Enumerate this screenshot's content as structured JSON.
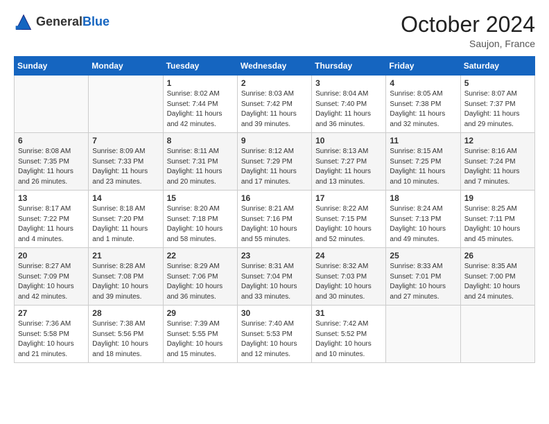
{
  "header": {
    "logo_general": "General",
    "logo_blue": "Blue",
    "month_title": "October 2024",
    "location": "Saujon, France"
  },
  "weekdays": [
    "Sunday",
    "Monday",
    "Tuesday",
    "Wednesday",
    "Thursday",
    "Friday",
    "Saturday"
  ],
  "weeks": [
    [
      {
        "day": "",
        "sunrise": "",
        "sunset": "",
        "daylight": ""
      },
      {
        "day": "",
        "sunrise": "",
        "sunset": "",
        "daylight": ""
      },
      {
        "day": "1",
        "sunrise": "Sunrise: 8:02 AM",
        "sunset": "Sunset: 7:44 PM",
        "daylight": "Daylight: 11 hours and 42 minutes."
      },
      {
        "day": "2",
        "sunrise": "Sunrise: 8:03 AM",
        "sunset": "Sunset: 7:42 PM",
        "daylight": "Daylight: 11 hours and 39 minutes."
      },
      {
        "day": "3",
        "sunrise": "Sunrise: 8:04 AM",
        "sunset": "Sunset: 7:40 PM",
        "daylight": "Daylight: 11 hours and 36 minutes."
      },
      {
        "day": "4",
        "sunrise": "Sunrise: 8:05 AM",
        "sunset": "Sunset: 7:38 PM",
        "daylight": "Daylight: 11 hours and 32 minutes."
      },
      {
        "day": "5",
        "sunrise": "Sunrise: 8:07 AM",
        "sunset": "Sunset: 7:37 PM",
        "daylight": "Daylight: 11 hours and 29 minutes."
      }
    ],
    [
      {
        "day": "6",
        "sunrise": "Sunrise: 8:08 AM",
        "sunset": "Sunset: 7:35 PM",
        "daylight": "Daylight: 11 hours and 26 minutes."
      },
      {
        "day": "7",
        "sunrise": "Sunrise: 8:09 AM",
        "sunset": "Sunset: 7:33 PM",
        "daylight": "Daylight: 11 hours and 23 minutes."
      },
      {
        "day": "8",
        "sunrise": "Sunrise: 8:11 AM",
        "sunset": "Sunset: 7:31 PM",
        "daylight": "Daylight: 11 hours and 20 minutes."
      },
      {
        "day": "9",
        "sunrise": "Sunrise: 8:12 AM",
        "sunset": "Sunset: 7:29 PM",
        "daylight": "Daylight: 11 hours and 17 minutes."
      },
      {
        "day": "10",
        "sunrise": "Sunrise: 8:13 AM",
        "sunset": "Sunset: 7:27 PM",
        "daylight": "Daylight: 11 hours and 13 minutes."
      },
      {
        "day": "11",
        "sunrise": "Sunrise: 8:15 AM",
        "sunset": "Sunset: 7:25 PM",
        "daylight": "Daylight: 11 hours and 10 minutes."
      },
      {
        "day": "12",
        "sunrise": "Sunrise: 8:16 AM",
        "sunset": "Sunset: 7:24 PM",
        "daylight": "Daylight: 11 hours and 7 minutes."
      }
    ],
    [
      {
        "day": "13",
        "sunrise": "Sunrise: 8:17 AM",
        "sunset": "Sunset: 7:22 PM",
        "daylight": "Daylight: 11 hours and 4 minutes."
      },
      {
        "day": "14",
        "sunrise": "Sunrise: 8:18 AM",
        "sunset": "Sunset: 7:20 PM",
        "daylight": "Daylight: 11 hours and 1 minute."
      },
      {
        "day": "15",
        "sunrise": "Sunrise: 8:20 AM",
        "sunset": "Sunset: 7:18 PM",
        "daylight": "Daylight: 10 hours and 58 minutes."
      },
      {
        "day": "16",
        "sunrise": "Sunrise: 8:21 AM",
        "sunset": "Sunset: 7:16 PM",
        "daylight": "Daylight: 10 hours and 55 minutes."
      },
      {
        "day": "17",
        "sunrise": "Sunrise: 8:22 AM",
        "sunset": "Sunset: 7:15 PM",
        "daylight": "Daylight: 10 hours and 52 minutes."
      },
      {
        "day": "18",
        "sunrise": "Sunrise: 8:24 AM",
        "sunset": "Sunset: 7:13 PM",
        "daylight": "Daylight: 10 hours and 49 minutes."
      },
      {
        "day": "19",
        "sunrise": "Sunrise: 8:25 AM",
        "sunset": "Sunset: 7:11 PM",
        "daylight": "Daylight: 10 hours and 45 minutes."
      }
    ],
    [
      {
        "day": "20",
        "sunrise": "Sunrise: 8:27 AM",
        "sunset": "Sunset: 7:09 PM",
        "daylight": "Daylight: 10 hours and 42 minutes."
      },
      {
        "day": "21",
        "sunrise": "Sunrise: 8:28 AM",
        "sunset": "Sunset: 7:08 PM",
        "daylight": "Daylight: 10 hours and 39 minutes."
      },
      {
        "day": "22",
        "sunrise": "Sunrise: 8:29 AM",
        "sunset": "Sunset: 7:06 PM",
        "daylight": "Daylight: 10 hours and 36 minutes."
      },
      {
        "day": "23",
        "sunrise": "Sunrise: 8:31 AM",
        "sunset": "Sunset: 7:04 PM",
        "daylight": "Daylight: 10 hours and 33 minutes."
      },
      {
        "day": "24",
        "sunrise": "Sunrise: 8:32 AM",
        "sunset": "Sunset: 7:03 PM",
        "daylight": "Daylight: 10 hours and 30 minutes."
      },
      {
        "day": "25",
        "sunrise": "Sunrise: 8:33 AM",
        "sunset": "Sunset: 7:01 PM",
        "daylight": "Daylight: 10 hours and 27 minutes."
      },
      {
        "day": "26",
        "sunrise": "Sunrise: 8:35 AM",
        "sunset": "Sunset: 7:00 PM",
        "daylight": "Daylight: 10 hours and 24 minutes."
      }
    ],
    [
      {
        "day": "27",
        "sunrise": "Sunrise: 7:36 AM",
        "sunset": "Sunset: 5:58 PM",
        "daylight": "Daylight: 10 hours and 21 minutes."
      },
      {
        "day": "28",
        "sunrise": "Sunrise: 7:38 AM",
        "sunset": "Sunset: 5:56 PM",
        "daylight": "Daylight: 10 hours and 18 minutes."
      },
      {
        "day": "29",
        "sunrise": "Sunrise: 7:39 AM",
        "sunset": "Sunset: 5:55 PM",
        "daylight": "Daylight: 10 hours and 15 minutes."
      },
      {
        "day": "30",
        "sunrise": "Sunrise: 7:40 AM",
        "sunset": "Sunset: 5:53 PM",
        "daylight": "Daylight: 10 hours and 12 minutes."
      },
      {
        "day": "31",
        "sunrise": "Sunrise: 7:42 AM",
        "sunset": "Sunset: 5:52 PM",
        "daylight": "Daylight: 10 hours and 10 minutes."
      },
      {
        "day": "",
        "sunrise": "",
        "sunset": "",
        "daylight": ""
      },
      {
        "day": "",
        "sunrise": "",
        "sunset": "",
        "daylight": ""
      }
    ]
  ]
}
